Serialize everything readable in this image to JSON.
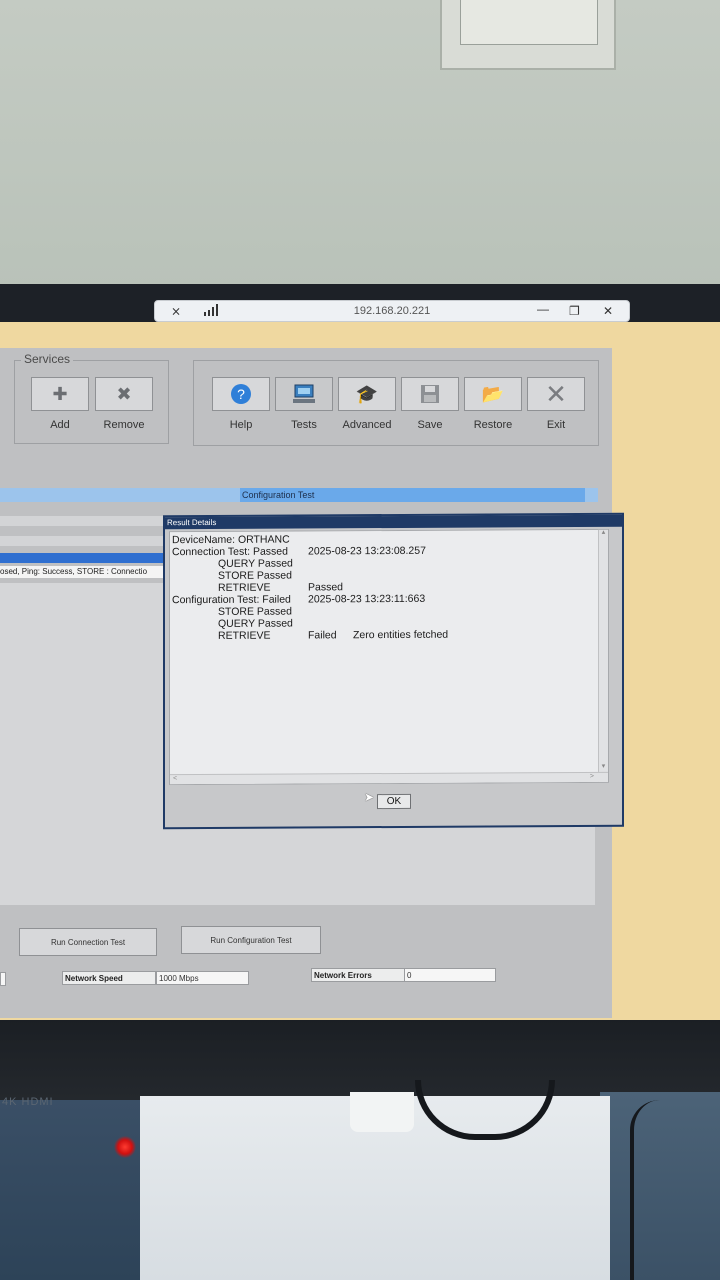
{
  "remote_bar": {
    "title": "192.168.20.221",
    "minimize_icon": "minimize-icon",
    "restore_icon": "restore-icon",
    "close_icon": "close-icon"
  },
  "services": {
    "label": "Services",
    "buttons": [
      {
        "label": "Add",
        "icon": "add-service-icon"
      },
      {
        "label": "Remove",
        "icon": "remove-service-icon"
      }
    ]
  },
  "toolbar": {
    "buttons": [
      {
        "label": "Help",
        "icon": "help-icon"
      },
      {
        "label": "Tests",
        "icon": "tests-icon"
      },
      {
        "label": "Advanced",
        "icon": "advanced-icon"
      },
      {
        "label": "Save",
        "icon": "save-icon"
      },
      {
        "label": "Restore",
        "icon": "restore-folder-icon"
      },
      {
        "label": "Exit",
        "icon": "exit-icon"
      }
    ]
  },
  "config_header": "Configuration Test",
  "selected_row_text": "osed, Ping: Success, STORE : Connectio",
  "dialog": {
    "title": "Result Details",
    "lines": [
      {
        "c1": "DeviceName: ORTHANC",
        "c2": "",
        "c3": ""
      },
      {
        "c1": "Connection Test: Passed",
        "c2": "2025-08-23 13:23:08.257",
        "c3": ""
      },
      {
        "c1": "QUERY  Passed",
        "c2": "",
        "c3": ""
      },
      {
        "c1": "STORE  Passed",
        "c2": "",
        "c3": ""
      },
      {
        "c1": "RETRIEVE",
        "c2": "Passed",
        "c3": ""
      },
      {
        "c1": "Configuration Test: Failed",
        "c2": "2025-08-23 13:23:11:663",
        "c3": ""
      },
      {
        "c1": "STORE  Passed",
        "c2": "",
        "c3": ""
      },
      {
        "c1": "QUERY  Passed",
        "c2": "",
        "c3": ""
      },
      {
        "c1": "RETRIEVE",
        "c2": "Failed",
        "c3": "Zero entities fetched"
      }
    ],
    "ok_label": "OK"
  },
  "bottom": {
    "run_connection": "Run Connection Test",
    "run_configuration": "Run Configuration Test",
    "network_speed_label": "Network Speed",
    "network_speed_value": "1000 Mbps",
    "network_errors_label": "Network Errors",
    "network_errors_value": "0"
  },
  "monitor_label": "4K HDMI"
}
